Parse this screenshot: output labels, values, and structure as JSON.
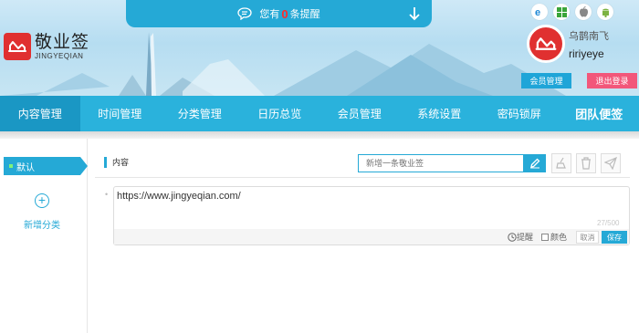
{
  "logo": {
    "title": "敬业签",
    "subtitle": "JINGYEQIAN"
  },
  "notice": {
    "prefix": "您有",
    "count": "0",
    "suffix": "条提醒"
  },
  "platforms": [
    "ie-icon",
    "windows-icon",
    "apple-icon",
    "android-icon"
  ],
  "user": {
    "nickname": "乌鹊南飞",
    "username": "ririyeye",
    "member_label": "会员管理",
    "logout_label": "退出登录"
  },
  "nav": {
    "items": [
      {
        "label": "内容管理",
        "active": true
      },
      {
        "label": "时间管理"
      },
      {
        "label": "分类管理"
      },
      {
        "label": "日历总览"
      },
      {
        "label": "会员管理"
      },
      {
        "label": "系统设置"
      },
      {
        "label": "密码锁屏"
      },
      {
        "label": "团队便签"
      }
    ]
  },
  "sidebar": {
    "default_category": "默认",
    "add_category": "新增分类"
  },
  "content": {
    "section_title": "内容",
    "new_placeholder": "新增一条敬业签",
    "note_text": "https://www.jingyeqian.com/",
    "note_count": "27/500",
    "remind_label": "提醒",
    "color_label": "颜色",
    "cancel_label": "取消",
    "save_label": "保存"
  },
  "colors": {
    "accent": "#25a9d6",
    "brand": "#e03030",
    "logout": "#f2577a",
    "nav": "#2ab2dc"
  }
}
